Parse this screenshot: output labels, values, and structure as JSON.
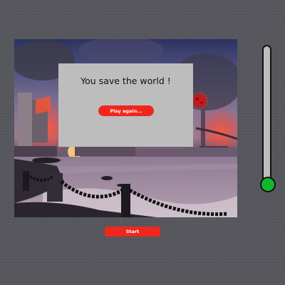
{
  "overlay": {
    "title": "You save the world !",
    "play_again_label": "Play again..."
  },
  "controls": {
    "start_label": "Start"
  },
  "meter": {
    "level": 0.04,
    "fill_color": "#13b52b"
  },
  "colors": {
    "button": "#f0271c",
    "overlay": "#bdbdbd",
    "background": "#55565c"
  },
  "scene": {
    "description_icon": "burning-city-coast-scene",
    "virus_icon": "red-virus-icon"
  }
}
